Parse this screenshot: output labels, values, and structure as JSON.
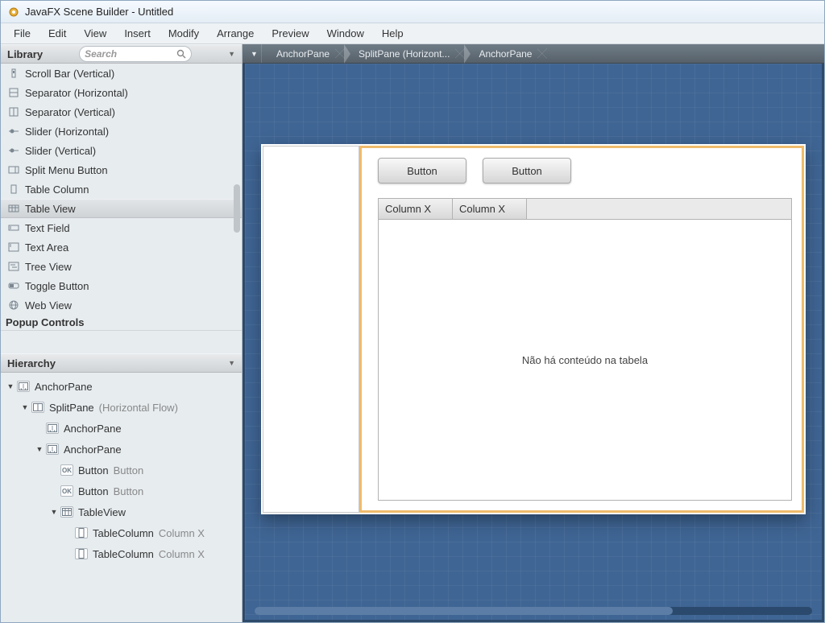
{
  "window": {
    "title": "JavaFX Scene Builder - Untitled"
  },
  "menu": [
    "File",
    "Edit",
    "View",
    "Insert",
    "Modify",
    "Arrange",
    "Preview",
    "Window",
    "Help"
  ],
  "library": {
    "title": "Library",
    "search_placeholder": "Search",
    "items": [
      {
        "label": "Scroll Bar (Vertical)",
        "icon": "scrollbar-v"
      },
      {
        "label": "Separator (Horizontal)",
        "icon": "separator-h"
      },
      {
        "label": "Separator (Vertical)",
        "icon": "separator-v"
      },
      {
        "label": "Slider (Horizontal)",
        "icon": "slider"
      },
      {
        "label": "Slider (Vertical)",
        "icon": "slider"
      },
      {
        "label": "Split Menu Button",
        "icon": "splitmenu"
      },
      {
        "label": "Table Column",
        "icon": "column"
      },
      {
        "label": "Table View",
        "icon": "table",
        "selected": true
      },
      {
        "label": "Text Field",
        "icon": "textfield"
      },
      {
        "label": "Text Area",
        "icon": "textarea"
      },
      {
        "label": "Tree View",
        "icon": "tree"
      },
      {
        "label": "Toggle Button",
        "icon": "toggle"
      },
      {
        "label": "Web View",
        "icon": "web"
      }
    ],
    "section_label": "Popup Controls"
  },
  "hierarchy": {
    "title": "Hierarchy",
    "tree": [
      {
        "depth": 0,
        "twisty": "▼",
        "icon": "anchor",
        "label": "AnchorPane"
      },
      {
        "depth": 1,
        "twisty": "▼",
        "icon": "split",
        "label": "SplitPane",
        "sublabel": "(Horizontal Flow)"
      },
      {
        "depth": 2,
        "twisty": "",
        "icon": "anchor",
        "label": "AnchorPane"
      },
      {
        "depth": 2,
        "twisty": "▼",
        "icon": "anchor",
        "label": "AnchorPane"
      },
      {
        "depth": 3,
        "twisty": "",
        "icon": "button",
        "label": "Button",
        "sublabel": "Button"
      },
      {
        "depth": 3,
        "twisty": "",
        "icon": "button",
        "label": "Button",
        "sublabel": "Button"
      },
      {
        "depth": 3,
        "twisty": "▼",
        "icon": "table",
        "label": "TableView"
      },
      {
        "depth": 4,
        "twisty": "",
        "icon": "column",
        "label": "TableColumn",
        "sublabel": "Column X"
      },
      {
        "depth": 4,
        "twisty": "",
        "icon": "column",
        "label": "TableColumn",
        "sublabel": "Column X"
      }
    ]
  },
  "breadcrumb": [
    "AnchorPane",
    "SplitPane (Horizont...",
    "AnchorPane"
  ],
  "canvas": {
    "buttons": [
      "Button",
      "Button"
    ],
    "columns": [
      "Column X",
      "Column X"
    ],
    "empty_table_text": "Não há conteúdo na tabela"
  }
}
